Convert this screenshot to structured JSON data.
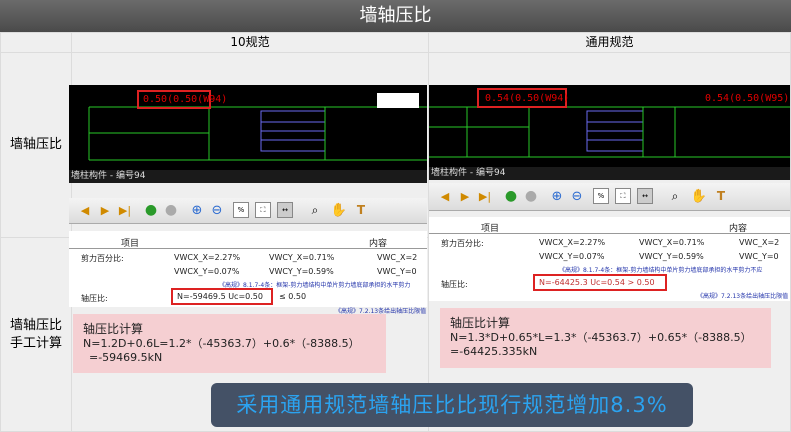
{
  "title": "墙轴压比",
  "columns": {
    "col1": "10规范",
    "col2": "通用规范"
  },
  "rows": {
    "row1": "墙轴压比",
    "row2_line1": "墙轴压比",
    "row2_line2": "手工计算"
  },
  "left": {
    "cad_label": "0.50(0.50(W94)",
    "status": "墙柱构件 - 编号94",
    "report": {
      "header_item": "项目",
      "header_content": "内容",
      "shear_label": "剪力百分比:",
      "vwcx": "VWCX_X=2.27%",
      "vwcy": "VWCY_X=0.71%",
      "vwc_x": "VWC_X=2",
      "vwcx2": "VWCX_Y=0.07%",
      "vwcy2": "VWCY_Y=0.59%",
      "vwc_y": "VWC_Y=0",
      "note1": "《高规》8.1.7-4条：框架-剪力墙结构中单片剪力墙底部承担的水平剪力",
      "axial_label": "轴压比:",
      "axial_value": "N=-59469.5   Uc=0.50",
      "axial_compare": "≤   0.50",
      "note2": "《高规》7.2.13条给出轴压比限值"
    },
    "calc": {
      "title": "轴压比计算",
      "line1": "N=1.2D+0.6L=1.2*（-45363.7）+0.6*（-8388.5）",
      "line2": "=-59469.5kN"
    }
  },
  "right": {
    "cad_label": "0.54(0.50(W94)",
    "cad_label2": "0.54(0.50(W95)",
    "status": "墙柱构件 - 编号94",
    "report": {
      "header_item": "项目",
      "header_content": "内容",
      "shear_label": "剪力百分比:",
      "vwcx": "VWCX_X=2.27%",
      "vwcy": "VWCY_X=0.71%",
      "vwc_x": "VWC_X=2",
      "vwcx2": "VWCX_Y=0.07%",
      "vwcy2": "VWCY_Y=0.59%",
      "vwc_y": "VWC_Y=0",
      "note1": "《高规》8.1.7-4条：框架-剪力墙结构中单片剪力墙底部承担的水平剪力不应",
      "axial_label": "轴压比:",
      "axial_value": "N=-64425.3   Uc=0.54  >  0.50",
      "note2": "《高规》7.2.13条给出轴压比限值"
    },
    "calc": {
      "title": "轴压比计算",
      "line1": "N=1.3*D+0.65*L=1.3*（-45363.7）+0.65*（-8388.5）",
      "line2": "=-64425.335kN"
    }
  },
  "banner": "采用通用规范墙轴压比比现行规范增加8.3%",
  "colors": {
    "accent_red": "#d22222",
    "banner_bg": "#445166",
    "banner_text": "#2ba3f0",
    "calc_bg": "#f5cfd2"
  }
}
